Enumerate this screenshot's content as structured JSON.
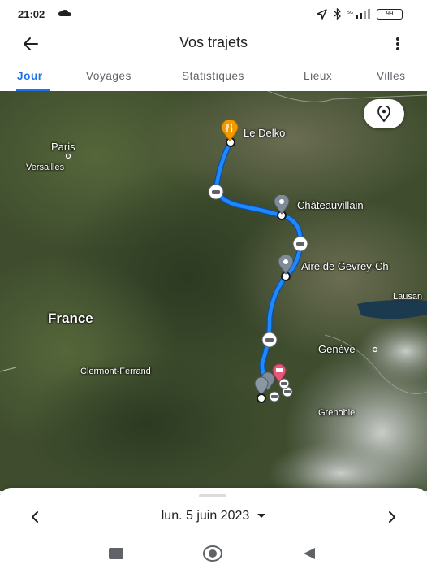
{
  "status_bar": {
    "time": "21:02",
    "battery": "99"
  },
  "app_bar": {
    "title": "Vos trajets"
  },
  "tabs": [
    {
      "label": "Jour",
      "active": true
    },
    {
      "label": "Voyages",
      "active": false
    },
    {
      "label": "Statistiques",
      "active": false
    },
    {
      "label": "Lieux",
      "active": false
    },
    {
      "label": "Villes",
      "active": false
    }
  ],
  "map": {
    "cities": {
      "paris": "Paris",
      "versailles": "Versailles",
      "france": "France",
      "clermont": "Clermont-Ferrand",
      "geneve": "Genève",
      "grenoble": "Grenoble",
      "lausanne": "Lausan"
    },
    "places": {
      "delko": "Le Delko",
      "chateauvillain": "Châteauvillain",
      "gevrey": "Aire de Gevrey-Ch"
    },
    "route_color": "#1e88ff",
    "restaurant_pin_color": "#f29900",
    "hotel_pin_color": "#e8557a",
    "place_pin_color": "#7f8c97"
  },
  "bottom_sheet": {
    "date": "lun. 5 juin 2023"
  },
  "colors": {
    "accent": "#1a73e8"
  }
}
